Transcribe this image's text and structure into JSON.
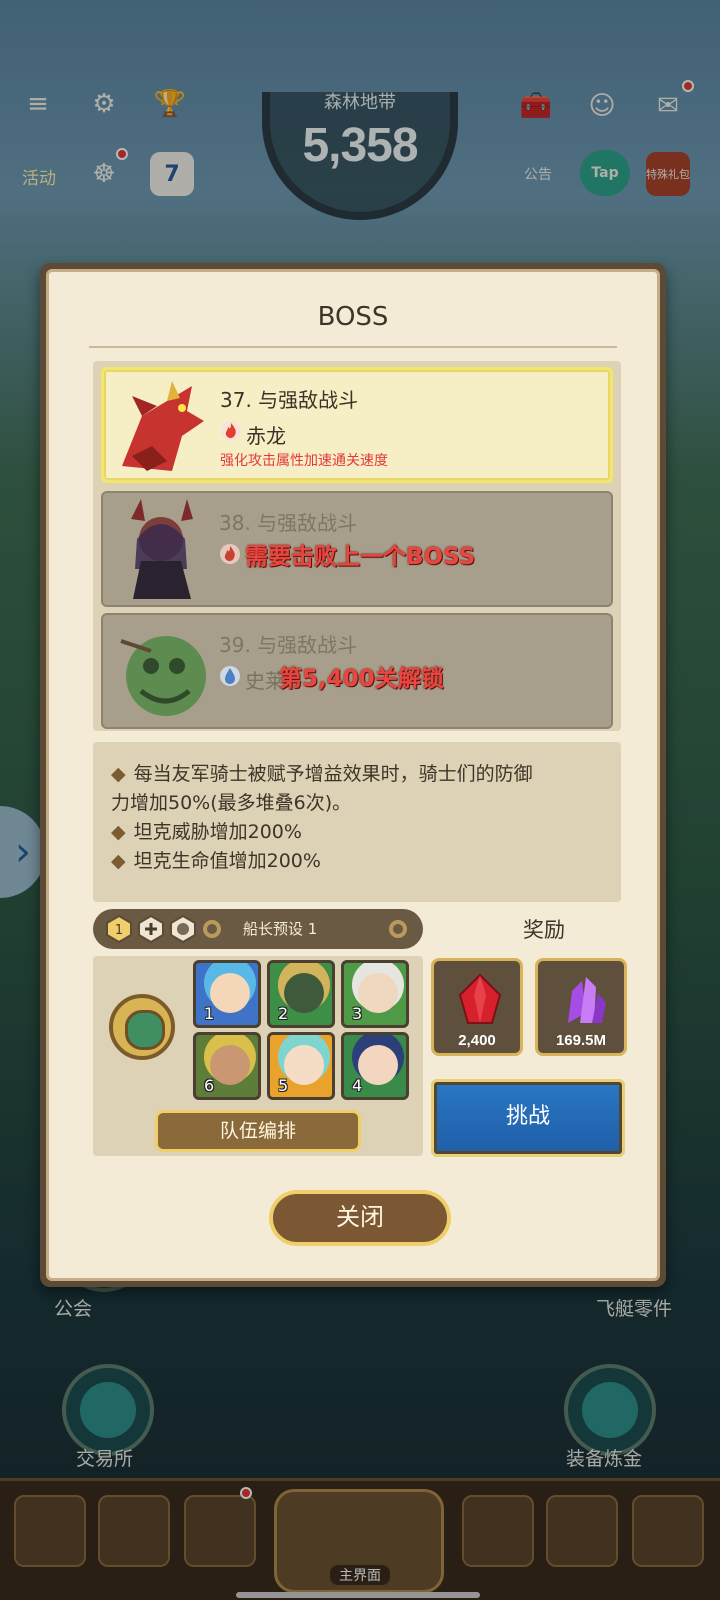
{
  "hud": {
    "zone_name": "森林地带",
    "zone_score": "5,358",
    "events_label": "活动",
    "calendar_day": "7",
    "notice_label": "公告",
    "tap_label": "Tap",
    "special_label": "特殊礼包"
  },
  "modal": {
    "title": "BOSS",
    "bosses": [
      {
        "stage": "37. 与强敌战斗",
        "name": "赤龙",
        "element_icon": "fire-element-icon",
        "description": "强化攻击属性加速通关速度",
        "state": "selected"
      },
      {
        "stage": "38. 与强敌战斗",
        "element_icon": "fire-element-icon",
        "lock_text": "需要击败上一个BOSS",
        "state": "locked"
      },
      {
        "stage": "39. 与强敌战斗",
        "name": "史莱",
        "element_icon": "water-element-icon",
        "lock_text": "第5,400关解锁",
        "state": "locked"
      }
    ],
    "effects": [
      "每当友军骑士被赋予增益效果时，骑士们的防御",
      "力增加50%(最多堆叠6次)。",
      "坦克威胁增加200%",
      "坦克生命值增加200%"
    ],
    "preset": {
      "slot_number": "1",
      "label": "船长预设 1"
    },
    "team_slots": [
      "1",
      "2",
      "3",
      "6",
      "5",
      "4"
    ],
    "team_button": "队伍编排",
    "reward_title": "奖励",
    "rewards": [
      {
        "icon": "ruby-gem-icon",
        "amount": "2,400"
      },
      {
        "icon": "purple-crystal-icon",
        "amount": "169.5M"
      }
    ],
    "challenge_button": "挑战",
    "close_button": "关闭"
  },
  "background": {
    "guild_label": "公会",
    "airship_parts_label": "飞艇零件",
    "exchange_label": "交易所",
    "equipment_label": "装备炼金",
    "main_nav_label": "主界面"
  },
  "colors": {
    "modal_bg": "#f3ebd6",
    "locked_text": "#e8463e",
    "challenge_blue": "#2a77c4",
    "gold_border": "#f0cf6a"
  }
}
